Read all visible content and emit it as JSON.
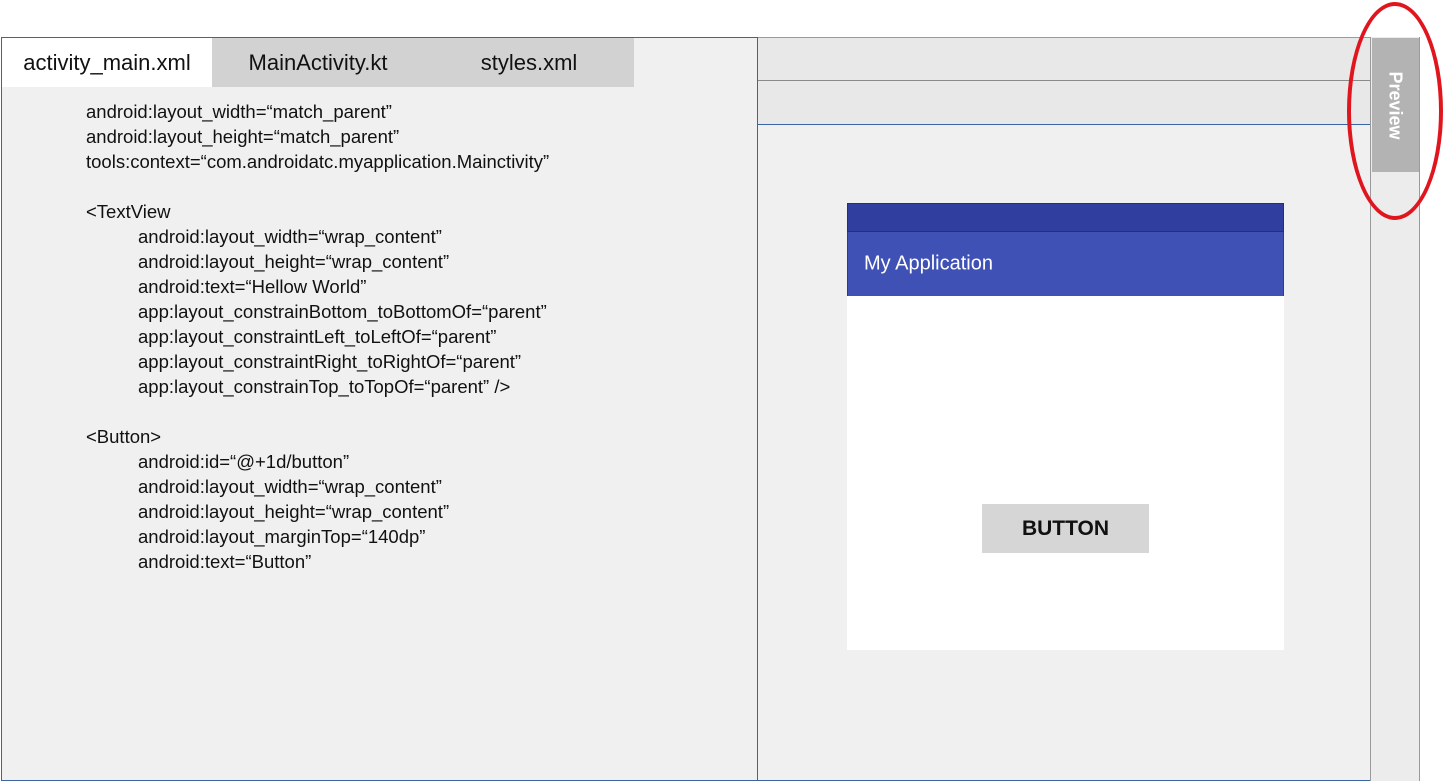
{
  "editor": {
    "tabs": [
      {
        "label": "activity_main.xml",
        "active": true
      },
      {
        "label": "MainActivity.kt",
        "active": false
      },
      {
        "label": "styles.xml",
        "active": false
      }
    ],
    "code_lines": [
      {
        "text": "android:layout_width=“match_parent”",
        "indent": 0
      },
      {
        "text": "android:layout_height=“match_parent”",
        "indent": 0
      },
      {
        "text": "tools:context=“com.androidatc.myapplication.Mainctivity”",
        "indent": 0
      },
      {
        "text": "",
        "indent": 0
      },
      {
        "text": "<TextView",
        "indent": 0
      },
      {
        "text": "android:layout_width=“wrap_content”",
        "indent": 1
      },
      {
        "text": "android:layout_height=“wrap_content”",
        "indent": 1
      },
      {
        "text": "android:text=“Hellow World”",
        "indent": 1
      },
      {
        "text": "app:layout_constrainBottom_toBottomOf=“parent”",
        "indent": 1
      },
      {
        "text": "app:layout_constraintLeft_toLeftOf=“parent”",
        "indent": 1
      },
      {
        "text": "app:layout_constraintRight_toRightOf=“parent”",
        "indent": 1
      },
      {
        "text": "app:layout_constrainTop_toTopOf=“parent” />",
        "indent": 1
      },
      {
        "text": "",
        "indent": 0
      },
      {
        "text": "<Button>",
        "indent": 0
      },
      {
        "text": "android:id=“@+1d/button”",
        "indent": 1
      },
      {
        "text": "android:layout_width=“wrap_content”",
        "indent": 1
      },
      {
        "text": "android:layout_height=“wrap_content”",
        "indent": 1
      },
      {
        "text": "android:layout_marginTop=“140dp”",
        "indent": 1
      },
      {
        "text": "android:text=“Button”",
        "indent": 1
      }
    ]
  },
  "preview": {
    "app_title": "My Application",
    "button_label": "BUTTON",
    "side_tab_label": "Preview"
  },
  "colors": {
    "status_bar": "#303f9f",
    "app_bar": "#3f51b5",
    "annotation": "#e0161e",
    "frame_border": "#3b64a0"
  }
}
